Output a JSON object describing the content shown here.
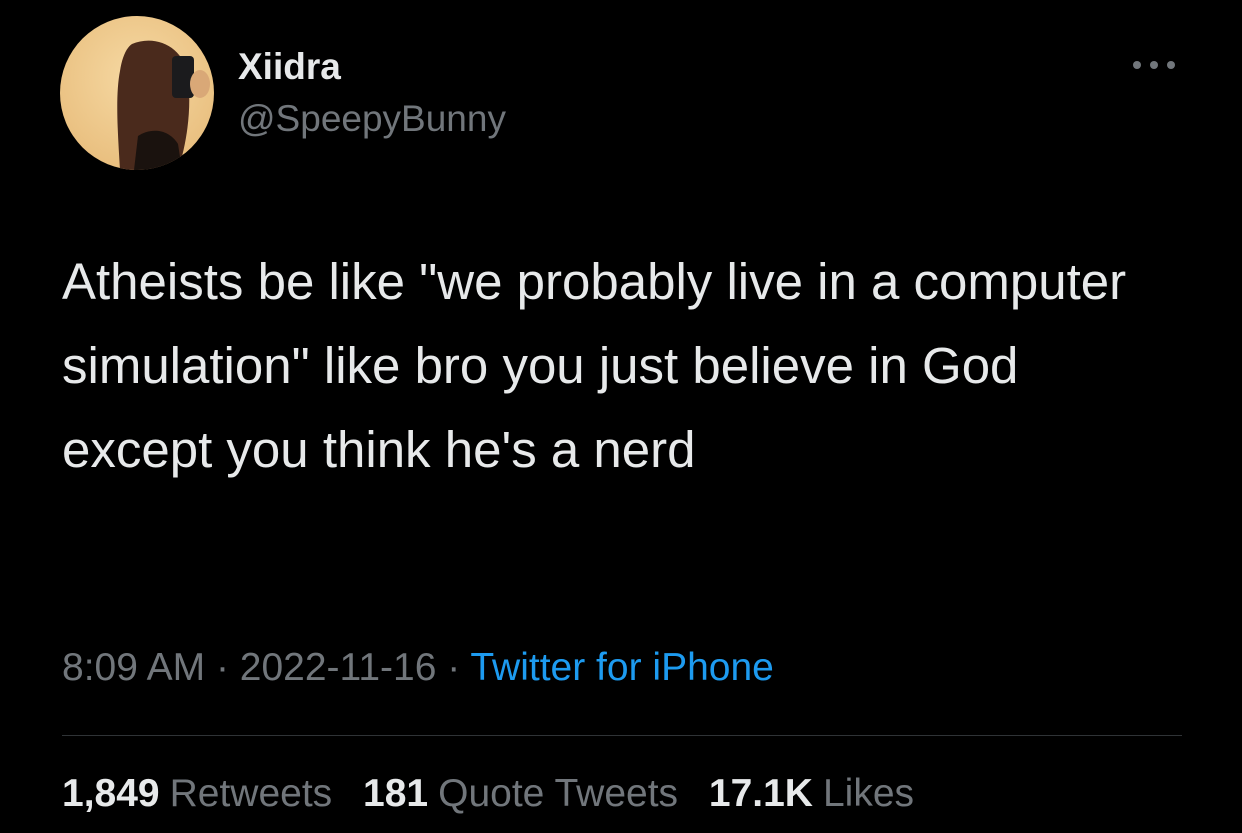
{
  "user": {
    "display_name": "Xiidra",
    "handle": "@SpeepyBunny",
    "avatar_icon": "profile-photo"
  },
  "more_icon": "more-horizontal-icon",
  "tweet": {
    "text": "Atheists be like \"we probably live in a computer simulation\" like bro you just believe in God except you think he's a nerd"
  },
  "meta": {
    "time": "8:09 AM",
    "separator": "·",
    "date": "2022-11-16",
    "source": "Twitter for iPhone"
  },
  "stats": {
    "retweets_count": "1,849",
    "retweets_label": "Retweets",
    "quotes_count": "181",
    "quotes_label": "Quote Tweets",
    "likes_count": "17.1K",
    "likes_label": "Likes"
  },
  "colors": {
    "background": "#000000",
    "text_primary": "#e7e9ea",
    "text_secondary": "#71767b",
    "link": "#1d9bf0",
    "divider": "#2f3336"
  }
}
